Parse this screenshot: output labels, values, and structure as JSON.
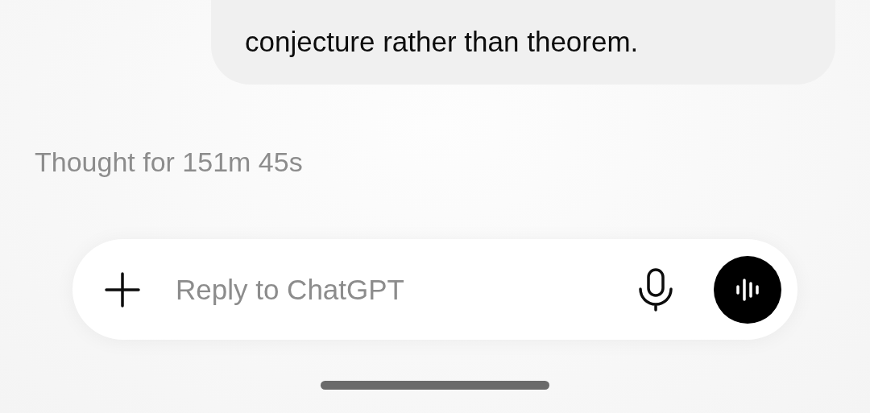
{
  "message": {
    "text": "conjecture rather than theorem."
  },
  "thought": {
    "label": "Thought for 151m 45s"
  },
  "composer": {
    "placeholder": "Reply to ChatGPT"
  }
}
